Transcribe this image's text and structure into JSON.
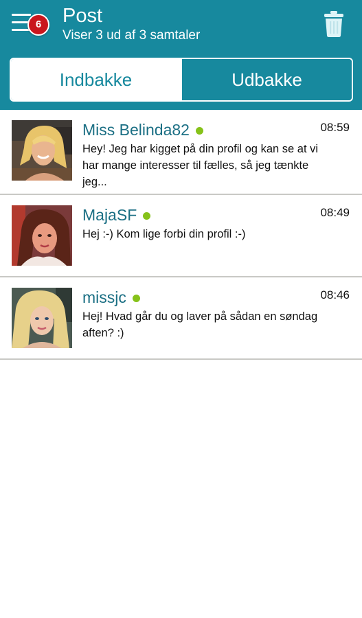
{
  "header": {
    "title": "Post",
    "subtitle": "Viser 3 ud af 3 samtaler",
    "menu_icon": "hamburger-menu-icon",
    "badge_count": "6",
    "trash_icon": "trash-icon",
    "background_color": "#17899e",
    "badge_color": "#c9161d"
  },
  "tabs": [
    {
      "label": "Indbakke",
      "selected": false
    },
    {
      "label": "Udbakke",
      "selected": true
    }
  ],
  "conversations": [
    {
      "name": "Miss Belinda82",
      "online": true,
      "time": "08:59",
      "message": "Hey! Jeg har kigget på din profil og kan se at vi har mange interesser til fælles, så jeg tænkte jeg..."
    },
    {
      "name": "MajaSF",
      "online": true,
      "time": "08:49",
      "message": "Hej :-) Kom lige forbi din profil :-)"
    },
    {
      "name": "missjc",
      "online": true,
      "time": "08:46",
      "message": "Hej! Hvad går du og laver på sådan en søndag aften? :)"
    }
  ],
  "colors": {
    "accent": "#17899e",
    "name_text": "#1b6f84",
    "online_dot": "#86c21a",
    "divider": "#c9c9c5"
  }
}
